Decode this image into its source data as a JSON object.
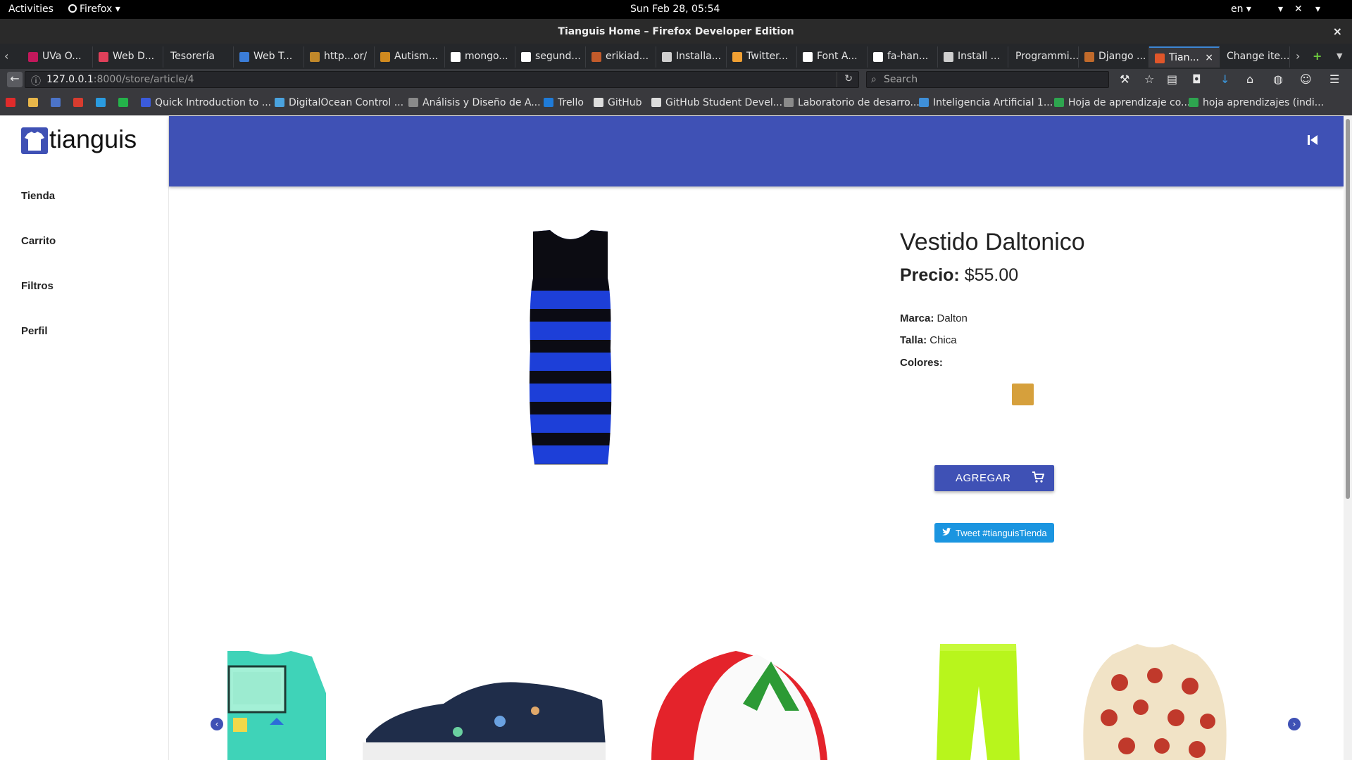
{
  "gnome": {
    "activities": "Activities",
    "app_menu": "Firefox ▾",
    "clock": "Sun Feb 28, 05:54",
    "lang": "en ▾"
  },
  "window": {
    "title": "Tianguis Home – Firefox Developer Edition",
    "close": "×"
  },
  "tabs": [
    {
      "label": "UVa O...",
      "color": "#c2185b"
    },
    {
      "label": "Web D...",
      "color": "#e0405a"
    },
    {
      "label": "Tesorería",
      "color": ""
    },
    {
      "label": "Web T...",
      "color": "#3b7dd8"
    },
    {
      "label": "http...or/",
      "color": "#c0882a"
    },
    {
      "label": "Autism...",
      "color": "#d08a1f"
    },
    {
      "label": "mongo...",
      "color": "#ffffff"
    },
    {
      "label": "segund...",
      "color": "#ffffff"
    },
    {
      "label": "erikiad...",
      "color": "#c25b2b"
    },
    {
      "label": "Installa...",
      "color": "#cfcfcf"
    },
    {
      "label": "Twitter...",
      "color": "#f0a033"
    },
    {
      "label": "Font A...",
      "color": "#ffffff"
    },
    {
      "label": "fa-han...",
      "color": "#ffffff"
    },
    {
      "label": "Install ...",
      "color": "#cfcfcf"
    },
    {
      "label": "Programmi...",
      "color": ""
    },
    {
      "label": "Django ...",
      "color": "#c06a2b"
    },
    {
      "label": "Tian...",
      "color": "#e0562a"
    },
    {
      "label": "Change ite...",
      "color": ""
    }
  ],
  "nav": {
    "url_host": "127.0.0.1",
    "url_rest": ":8000/store/article/4",
    "search_placeholder": "Search"
  },
  "bookmarks": [
    {
      "label": "Quick Introduction to ...",
      "color": "#3b5bdb"
    },
    {
      "label": "DigitalOcean Control ...",
      "color": "#4aa3df"
    },
    {
      "label": "Análisis y Diseño de A...",
      "color": "#8a8a8a"
    },
    {
      "label": "Trello",
      "color": "#1f7bd8"
    },
    {
      "label": "GitHub",
      "color": "#dddddd"
    },
    {
      "label": "GitHub Student Devel...",
      "color": "#dddddd"
    },
    {
      "label": "Laboratorio de desarro...",
      "color": "#8a8a8a"
    },
    {
      "label": "Inteligencia Artificial 1...",
      "color": "#3f8fd8"
    },
    {
      "label": "Hoja de aprendizaje co...",
      "color": "#2ea44f"
    },
    {
      "label": "hoja aprendizajes (indi...",
      "color": "#2ea44f"
    }
  ],
  "app": {
    "logo_text": "tianguis",
    "menu": [
      "Tienda",
      "Carrito",
      "Filtros",
      "Perfil"
    ],
    "accent": "#3f51b5"
  },
  "product": {
    "title": "Vestido Daltonico",
    "price_label": "Precio:",
    "price": "$55.00",
    "brand_label": "Marca:",
    "brand": "Dalton",
    "size_label": "Talla:",
    "size": "Chica",
    "colors_label": "Colores:",
    "swatch_color": "#d6a03c",
    "add_label": "AGREGAR",
    "tweet_label": "Tweet #tianguisTienda"
  },
  "carousel": {
    "items": [
      "game-over-sweater",
      "patterned-sneaker",
      "trucker-cap",
      "neon-pants",
      "pizza-sweater"
    ]
  }
}
